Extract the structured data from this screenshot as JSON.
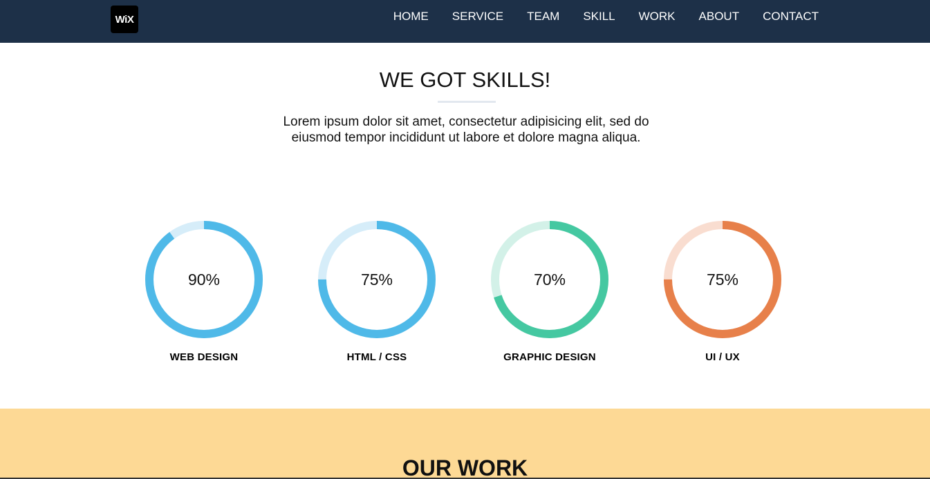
{
  "header": {
    "logo_text": "WiX",
    "nav": [
      "HOME",
      "SERVICE",
      "TEAM",
      "SKILL",
      "WORK",
      "ABOUT",
      "CONTACT"
    ]
  },
  "skills_section": {
    "title": "WE GOT SKILLS!",
    "intro_line1": "Lorem ipsum dolor sit amet, consectetur adipisicing elit, sed do",
    "intro_line2": "eiusmod tempor incididunt ut labore et dolore magna aliqua.",
    "skills": [
      {
        "label": "WEB DESIGN",
        "percent_text": "90%",
        "value": 0.9,
        "color": "#4fb9e8",
        "track": "#d6edf9"
      },
      {
        "label": "HTML / CSS",
        "percent_text": "75%",
        "value": 0.75,
        "color": "#4fb9e8",
        "track": "#d6edf9"
      },
      {
        "label": "GRAPHIC DESIGN",
        "percent_text": "70%",
        "value": 0.7,
        "color": "#45c8a1",
        "track": "#d3f1e8"
      },
      {
        "label": "UI / UX",
        "percent_text": "75%",
        "value": 0.75,
        "color": "#e7804a",
        "track": "#f9ddd0"
      }
    ]
  },
  "work_section": {
    "title": "OUR WORK",
    "background": "#fdd995"
  },
  "colors": {
    "navbar": "#1d3048"
  }
}
